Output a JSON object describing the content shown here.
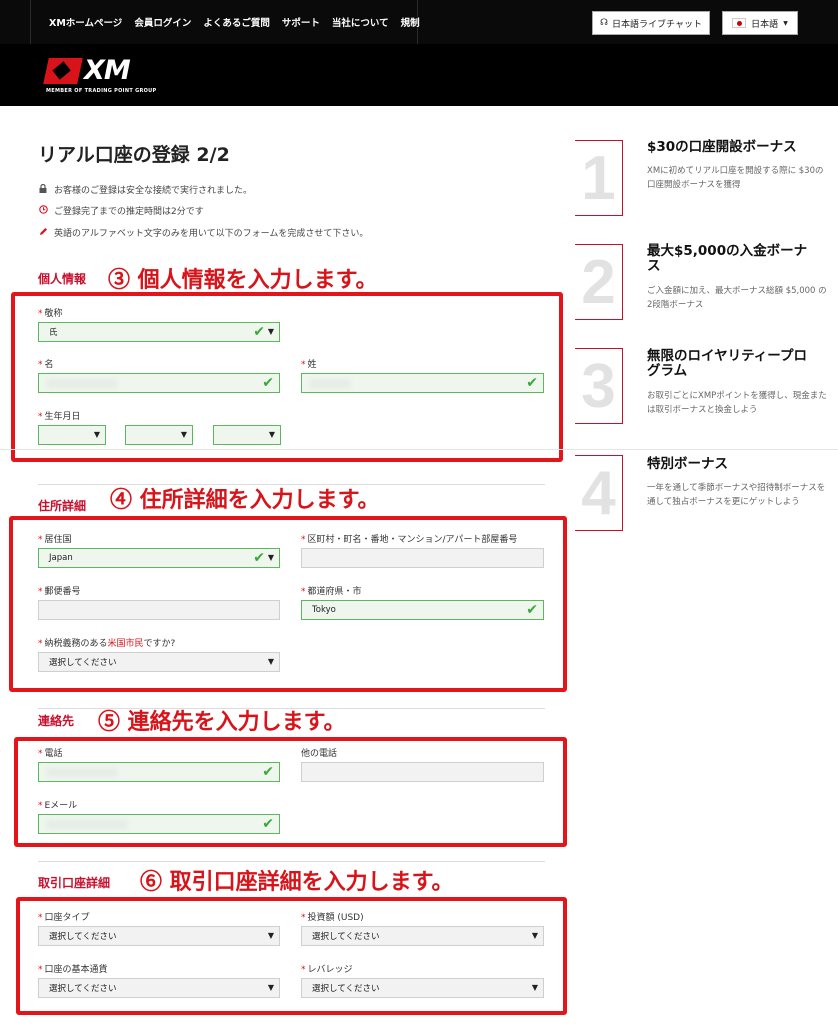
{
  "nav": {
    "links": [
      "XMホームページ",
      "会員ログイン",
      "よくあるご質問",
      "サポート",
      "当社について",
      "規制"
    ],
    "chat_label": "日本語ライブチャット",
    "lang_label": "日本語"
  },
  "logo": {
    "name": "XM",
    "tagline": "MEMBER OF TRADING POINT GROUP"
  },
  "page": {
    "title": "リアル口座の登録 2/2",
    "info": [
      "お客様のご登録は安全な接続で実行されました。",
      "ご登録完了までの推定時間は2分です",
      "英語のアルファベット文字のみを用いて以下のフォームを完成させて下さい。"
    ]
  },
  "sections": {
    "personal": {
      "label": "個人情報",
      "annotation": "③ 個人情報を入力します。",
      "honorific_label": "敬称",
      "honorific_value": "氏",
      "first_name_label": "名",
      "last_name_label": "姓",
      "dob_label": "生年月日"
    },
    "address": {
      "label": "住所詳細",
      "annotation": "④ 住所詳細を入力します。",
      "country_label": "居住国",
      "country_value": "Japan",
      "street_label": "区町村・町名・番地・マンション/アパート部屋番号",
      "postal_label": "郵便番号",
      "city_label": "都道府県・市",
      "city_value": "Tokyo",
      "us_tax_label_pre": "納税義務のある",
      "us_tax_label_hl": "米国市民",
      "us_tax_label_post": "ですか?",
      "us_tax_value": "選択してください"
    },
    "contact": {
      "label": "連絡先",
      "annotation": "⑤ 連絡先を入力します。",
      "phone_label": "電話",
      "other_phone_label": "他の電話",
      "email_label": "Eメール"
    },
    "account": {
      "label": "取引口座詳細",
      "annotation": "⑥ 取引口座詳細を入力します。",
      "type_label": "口座タイプ",
      "type_value": "選択してください",
      "investment_label": "投資額 (USD)",
      "investment_value": "選択してください",
      "currency_label": "口座の基本通貨",
      "currency_value": "選択してください",
      "leverage_label": "レバレッジ",
      "leverage_value": "選択してください"
    }
  },
  "sidebar": [
    {
      "num": "1",
      "title": "$30の口座開設ボーナス",
      "desc": "XMに初めてリアル口座を開設する際に $30の口座開設ボーナスを獲得"
    },
    {
      "num": "2",
      "title": "最大$5,000の入金ボーナス",
      "desc": "ご入金額に加え、最大ボーナス総額 $5,000 の2段階ボーナス"
    },
    {
      "num": "3",
      "title": "無限のロイヤリティープログラム",
      "desc": "お取引ごとにXMPポイントを獲得し、現金または取引ボーナスと換金しよう"
    },
    {
      "num": "4",
      "title": "特別ボーナス",
      "desc": "一年を通して季節ボーナスや招待制ボーナスを通して独占ボーナスを更にゲットしよう"
    }
  ],
  "icons": {
    "lock": "lock-icon",
    "clock": "clock-icon",
    "pencil": "pencil-icon",
    "check": "✔",
    "caret": "▼",
    "chat": "☊"
  },
  "colors": {
    "accent": "#d8141a",
    "ok": "#3aa83a",
    "nav_bg": "#0a0a0a"
  }
}
